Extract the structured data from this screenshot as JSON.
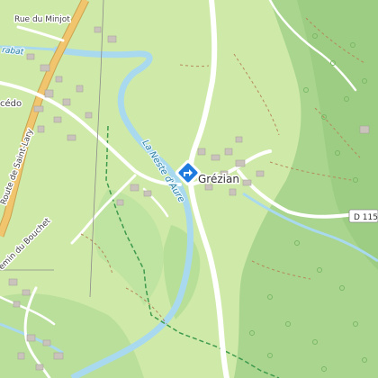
{
  "map": {
    "town_label": "Grézian",
    "places": {
      "cedo": "cédo"
    },
    "roads": {
      "rue_du_minjot": "Rue du Minjot",
      "route_de_saint_lary": "Route de Saint-Lary",
      "chemin_du_bouchet": "emin du Bouchet",
      "d115_shield": "D 115"
    },
    "water": {
      "river": "La Neste d'Aure",
      "stream_top": "rabat"
    },
    "marker": {
      "icon": "directions-marker-icon",
      "color": "#1f7ae0"
    },
    "colors": {
      "meadow": "#cfeaa8",
      "forest": "#a9d58e",
      "water": "#a9d9ee",
      "road_major": "#f1c46e",
      "road_minor": "#ffffff",
      "buildings": "#c9c3bb",
      "boundary": "#3f9a4f"
    }
  }
}
